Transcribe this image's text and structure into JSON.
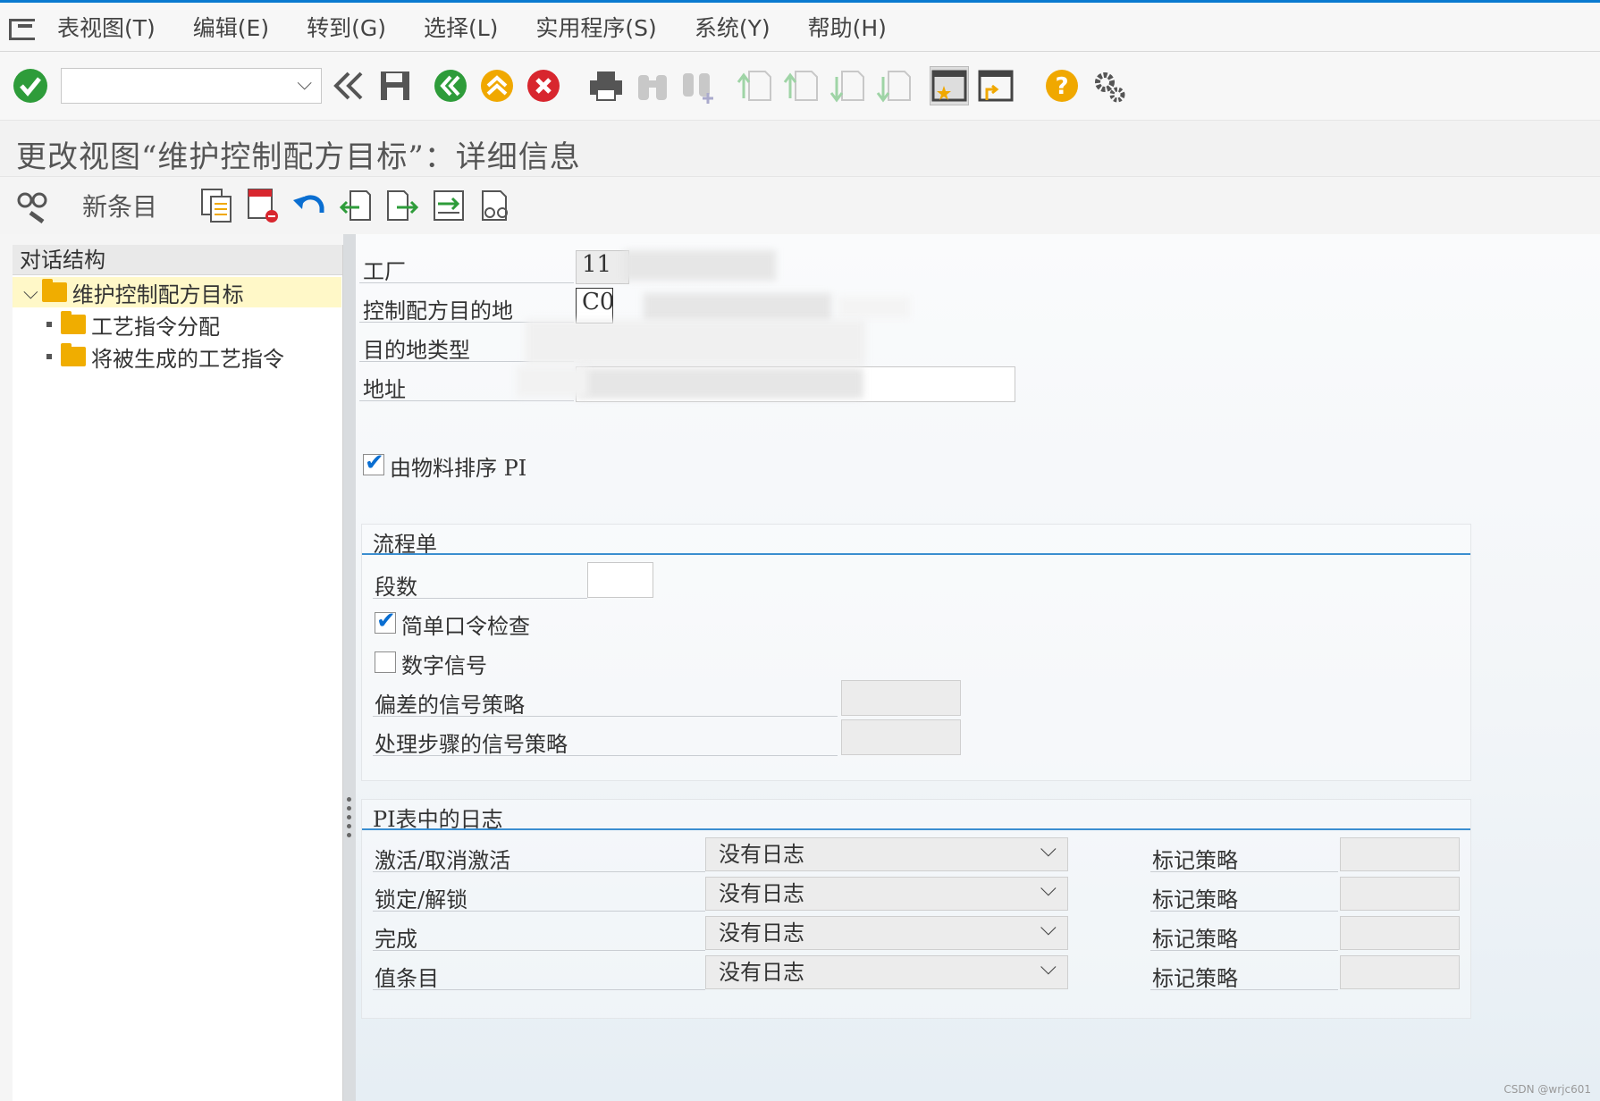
{
  "menu": [
    "表视图(T)",
    "编辑(E)",
    "转到(G)",
    "选择(L)",
    "实用程序(S)",
    "系统(Y)",
    "帮助(H)"
  ],
  "toolbar": {
    "command_value": "",
    "icons": [
      "enter-icon",
      "back-double-icon",
      "save-icon",
      "back-icon",
      "exit-icon",
      "cancel-icon",
      "print-icon",
      "find-icon",
      "find-next-icon",
      "first-page-icon",
      "prev-page-icon",
      "next-page-icon",
      "last-page-icon",
      "new-session-icon",
      "shortcut-icon",
      "help-icon",
      "settings-icon"
    ]
  },
  "title": "更改视图“维护控制配方目标”：详细信息",
  "app_toolbar": {
    "new_entry": "新条目"
  },
  "tree": {
    "header": "对话结构",
    "root": "维护控制配方目标",
    "children": [
      "工艺指令分配",
      "将被生成的工艺指令"
    ]
  },
  "form": {
    "plant_label": "工厂",
    "plant_value": "11",
    "destination_label": "控制配方目的地",
    "destination_value": "C0",
    "dest_type_label": "目的地类型",
    "address_label": "地址",
    "sort_checkbox_label": "由物料排序 PI",
    "sort_checked": true
  },
  "flow_group": {
    "title": "流程单",
    "segments_label": "段数",
    "segments_value": "",
    "simple_check_label": "简单口令检查",
    "simple_check_checked": true,
    "digital_sig_label": "数字信号",
    "digital_sig_checked": false,
    "deviation_label": "偏差的信号策略",
    "step_label": "处理步骤的信号策略"
  },
  "log_group": {
    "title": "PI表中的日志",
    "rows": [
      {
        "label": "激活/取消激活",
        "value": "没有日志",
        "strategy": "标记策略"
      },
      {
        "label": "锁定/解锁",
        "value": "没有日志",
        "strategy": "标记策略"
      },
      {
        "label": "完成",
        "value": "没有日志",
        "strategy": "标记策略"
      },
      {
        "label": "值条目",
        "value": "没有日志",
        "strategy": "标记策略"
      }
    ]
  },
  "watermark": "CSDN @wrjc601"
}
